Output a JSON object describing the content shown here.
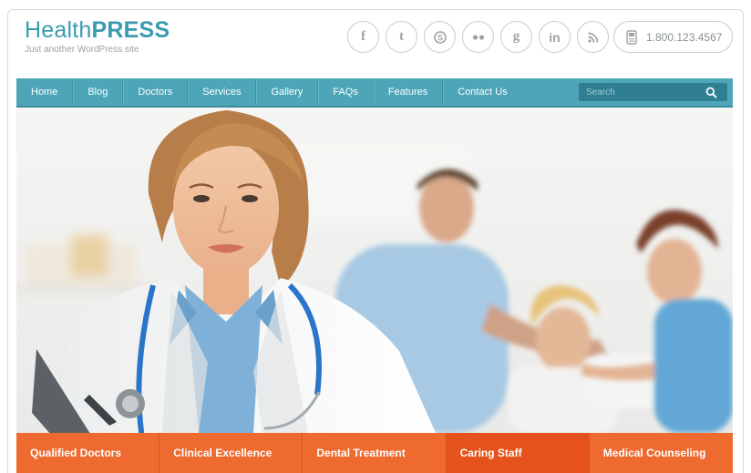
{
  "logo": {
    "title_light": "Health",
    "title_bold": "PRESS",
    "tagline": "Just another WordPress site"
  },
  "socials": [
    {
      "name": "facebook-icon",
      "glyph": "f"
    },
    {
      "name": "twitter-icon",
      "glyph": "t"
    },
    {
      "name": "skype-icon",
      "glyph": "S"
    },
    {
      "name": "flickr-icon",
      "glyph": "●●"
    },
    {
      "name": "google-icon",
      "glyph": "g"
    },
    {
      "name": "linkedin-icon",
      "glyph": "in"
    },
    {
      "name": "rss-icon",
      "glyph": "rss"
    }
  ],
  "phone": {
    "number": "1.800.123.4567"
  },
  "nav": {
    "items": [
      "Home",
      "Blog",
      "Doctors",
      "Services",
      "Gallery",
      "FAQs",
      "Features",
      "Contact Us"
    ],
    "search_placeholder": "Search"
  },
  "tabs": {
    "items": [
      "Qualified Doctors",
      "Clinical Excellence",
      "Dental Treatment",
      "Caring Staff",
      "Medical Counseling"
    ],
    "active": "Caring Staff"
  },
  "colors": {
    "brand": "#3a9bb0",
    "nav": "#4da6b8",
    "accent": "#ef6a2f"
  }
}
